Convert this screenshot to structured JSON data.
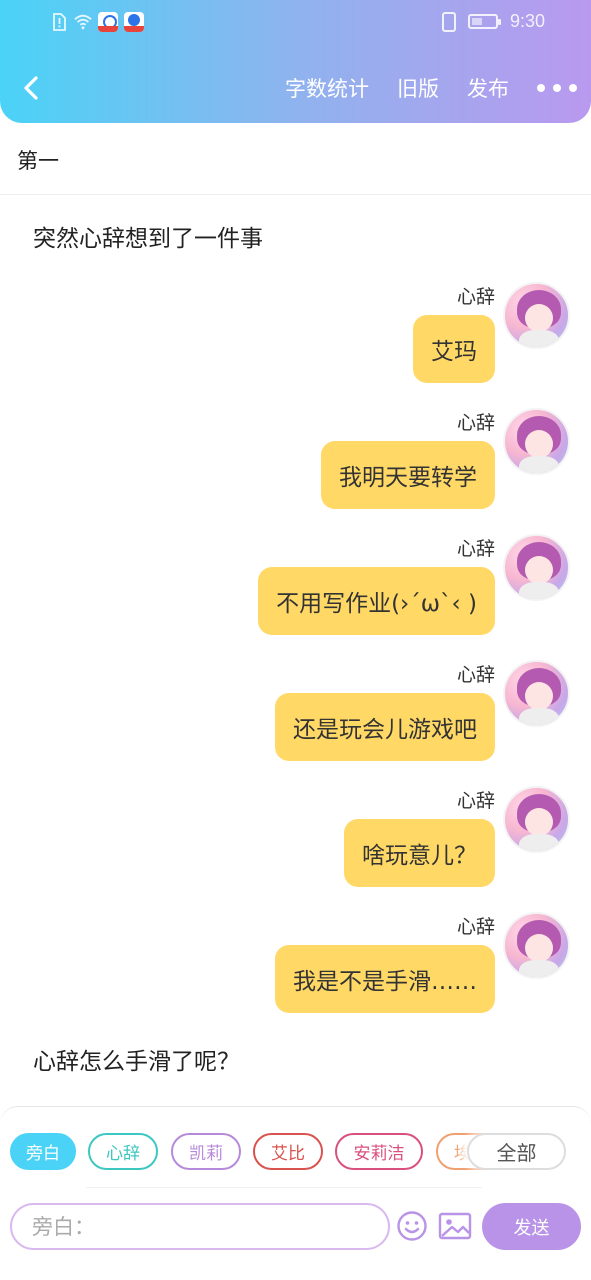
{
  "status_bar": {
    "time": "9:30"
  },
  "header": {
    "actions": {
      "word_count": "字数统计",
      "old_version": "旧版",
      "publish": "发布"
    }
  },
  "title": "第一",
  "narrations": [
    {
      "text": "突然心辞想到了一件事"
    },
    {
      "text": "心辞怎么手滑了呢？"
    }
  ],
  "messages": [
    {
      "name": "心辞",
      "text": "艾玛"
    },
    {
      "name": "心辞",
      "text": "我明天要转学"
    },
    {
      "name": "心辞",
      "text": "不用写作业(›´ω`‹ )"
    },
    {
      "name": "心辞",
      "text": "还是玩会儿游戏吧"
    },
    {
      "name": "心辞",
      "text": "啥玩意儿？"
    },
    {
      "name": "心辞",
      "text": "我是不是手滑……"
    }
  ],
  "roles": [
    {
      "label": "旁白",
      "color": "#4ad3f6",
      "selected": true
    },
    {
      "label": "心辞",
      "color": "#3cc7c0",
      "selected": false
    },
    {
      "label": "凯莉",
      "color": "#b78ad9",
      "selected": false
    },
    {
      "label": "艾比",
      "color": "#d9534f",
      "selected": false
    },
    {
      "label": "安莉洁",
      "color": "#d9507f",
      "selected": false
    },
    {
      "label": "埃",
      "color": "#f0a070",
      "selected": false
    }
  ],
  "all_button": "全部",
  "input": {
    "placeholder": "旁白："
  },
  "send_label": "发送",
  "icons": {
    "back": "chevron-left-icon",
    "more": "more-dots-icon",
    "emoji": "smiley-icon",
    "image": "image-icon"
  }
}
